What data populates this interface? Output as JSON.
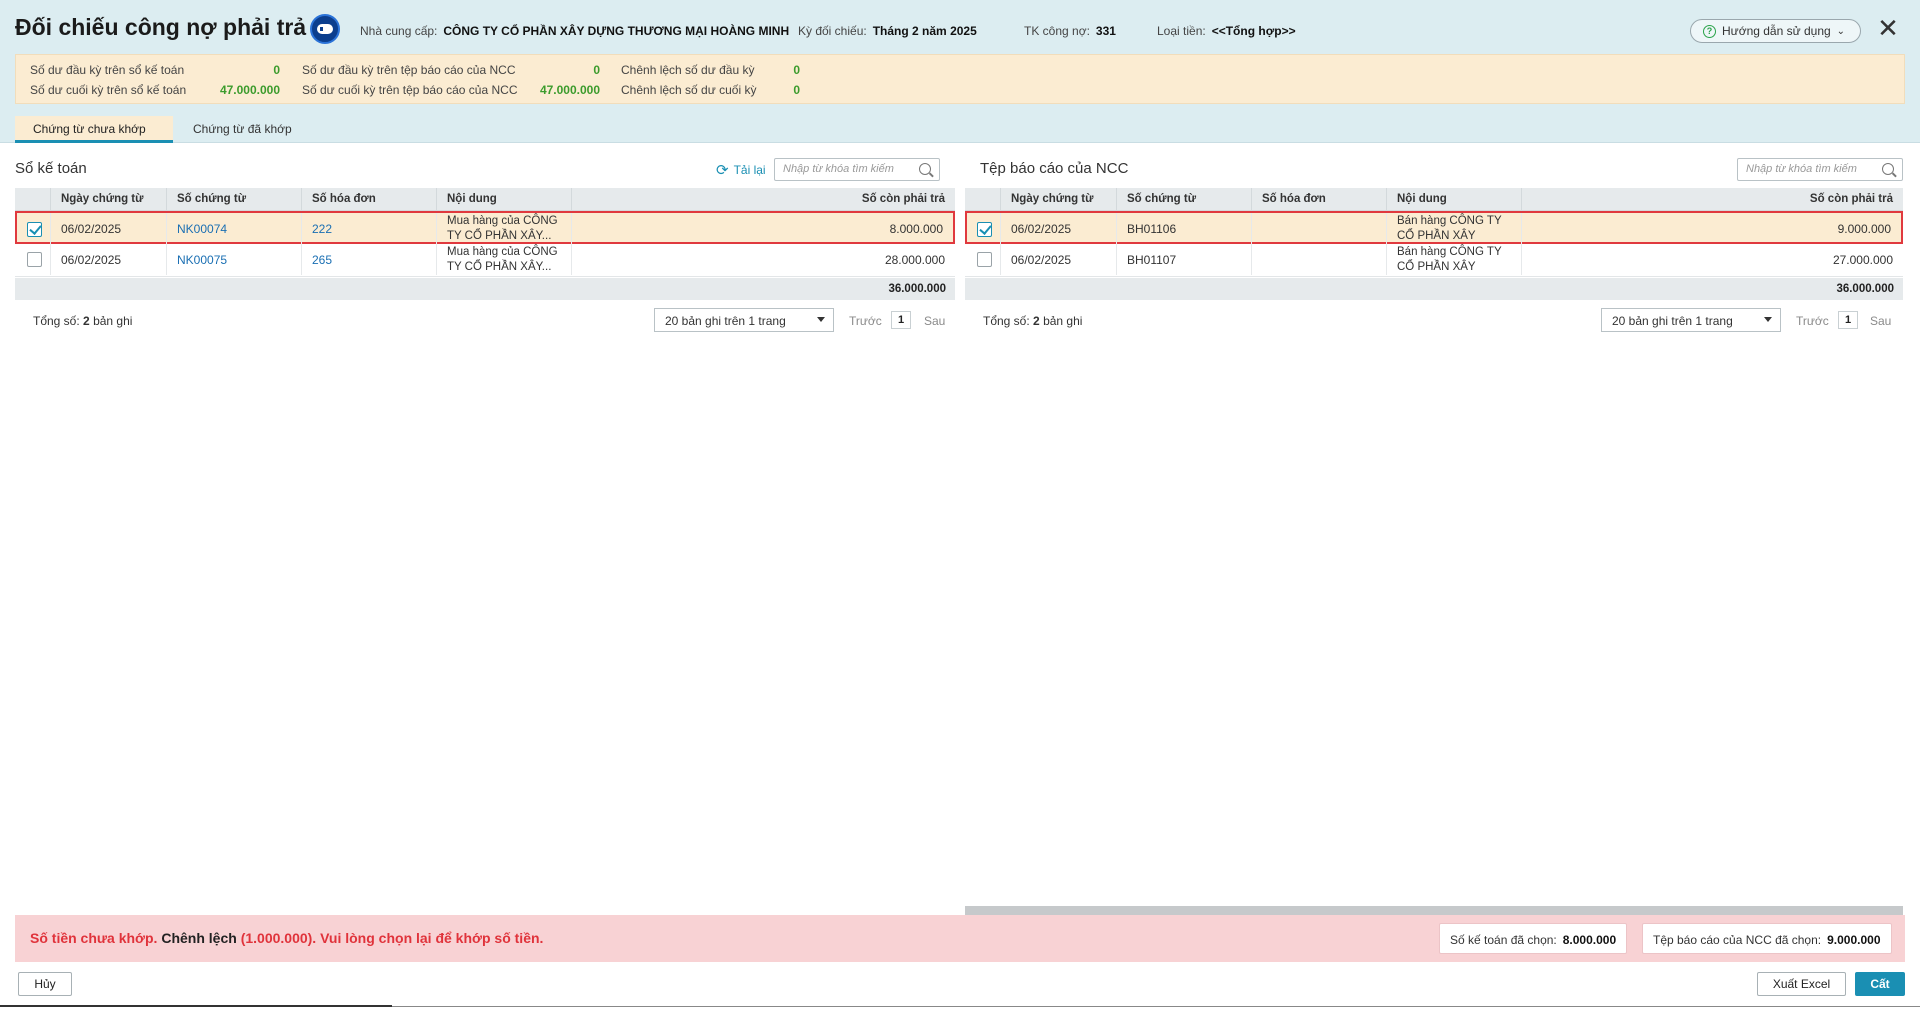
{
  "header": {
    "title": "Đối chiếu công nợ phải trả",
    "supplier_label": "Nhà cung cấp:",
    "supplier_value": "CÔNG TY CỔ PHẦN XÂY DỰNG THƯƠNG MẠI HOÀNG MINH",
    "period_label": "Kỳ đối chiếu:",
    "period_value": "Tháng 2 năm 2025",
    "account_label": "TK công nợ:",
    "account_value": "331",
    "currency_label": "Loại tiền:",
    "currency_value": "<<Tổng hợp>>",
    "help_button": "Hướng dẫn sử dụng",
    "close": "✕"
  },
  "summary": {
    "book_open_label": "Số dư đầu kỳ trên sổ kế toán",
    "book_open_value": "0",
    "book_close_label": "Số dư cuối kỳ trên sổ kế toán",
    "book_close_value": "47.000.000",
    "report_open_label": "Số dư đầu kỳ trên tệp báo cáo của NCC",
    "report_open_value": "0",
    "report_close_label": "Số dư cuối kỳ trên tệp báo cáo của NCC",
    "report_close_value": "47.000.000",
    "diff_open_label": "Chênh lệch số dư đầu kỳ",
    "diff_open_value": "0",
    "diff_close_label": "Chênh lệch số dư cuối kỳ",
    "diff_close_value": "0"
  },
  "tabs": {
    "unmatched": "Chứng từ chưa khớp",
    "matched": "Chứng từ đã khớp"
  },
  "left": {
    "title": "Sổ kế toán",
    "reload": "Tải lại",
    "search_placeholder": "Nhập từ khóa tìm kiếm",
    "columns": [
      "Ngày chứng từ",
      "Số chứng từ",
      "Số hóa đơn",
      "Nội dung",
      "Số còn phải trả"
    ],
    "rows": [
      {
        "checked": true,
        "date": "06/02/2025",
        "voucher": "NK00074",
        "invoice": "222",
        "content": "Mua hàng của CÔNG TY CỔ PHẦN XÂY...",
        "amount": "8.000.000"
      },
      {
        "checked": false,
        "date": "06/02/2025",
        "voucher": "NK00075",
        "invoice": "265",
        "content": "Mua hàng của CÔNG TY CỔ PHẦN XÂY...",
        "amount": "28.000.000"
      }
    ],
    "total": "36.000.000",
    "count_prefix": "Tổng số:",
    "count_value": "2",
    "count_suffix": "bản ghi",
    "page_size": "20 bản ghi trên 1 trang",
    "prev": "Trước",
    "page": "1",
    "next": "Sau"
  },
  "right": {
    "title": "Tệp báo cáo của NCC",
    "search_placeholder": "Nhập từ khóa tìm kiếm",
    "columns": [
      "Ngày chứng từ",
      "Số chứng từ",
      "Số hóa đơn",
      "Nội dung",
      "Số còn phải trả"
    ],
    "rows": [
      {
        "checked": true,
        "date": "06/02/2025",
        "voucher": "BH01106",
        "invoice": "",
        "content": "Bán hàng CÔNG TY CỔ PHẦN XÂY DỰN...",
        "amount": "9.000.000"
      },
      {
        "checked": false,
        "date": "06/02/2025",
        "voucher": "BH01107",
        "invoice": "",
        "content": "Bán hàng CÔNG TY CỔ PHẦN XÂY DỰN...",
        "amount": "27.000.000"
      }
    ],
    "total": "36.000.000",
    "count_prefix": "Tổng số:",
    "count_value": "2",
    "count_suffix": "bản ghi",
    "page_size": "20 bản ghi trên 1 trang",
    "prev": "Trước",
    "page": "1",
    "next": "Sau"
  },
  "error": {
    "part1": "Số tiền chưa khớp.",
    "part2": "Chênh lệch",
    "part3": "(1.000.000). Vui lòng chọn lại để khớp số tiền.",
    "book_selected_label": "Số kế toán đã chọn:",
    "book_selected_value": "8.000.000",
    "report_selected_label": "Tệp báo cáo của NCC đã chọn:",
    "report_selected_value": "9.000.000"
  },
  "footer": {
    "cancel": "Hủy",
    "export": "Xuất Excel",
    "save": "Cất"
  },
  "colors": {
    "header_bg": "#dcedf1",
    "summary_bg": "#fbecd2",
    "accent": "#1a8fb3",
    "error_bg": "#f8d2d4",
    "error_text": "#e0333b",
    "positive_value": "#3b9b2c"
  }
}
